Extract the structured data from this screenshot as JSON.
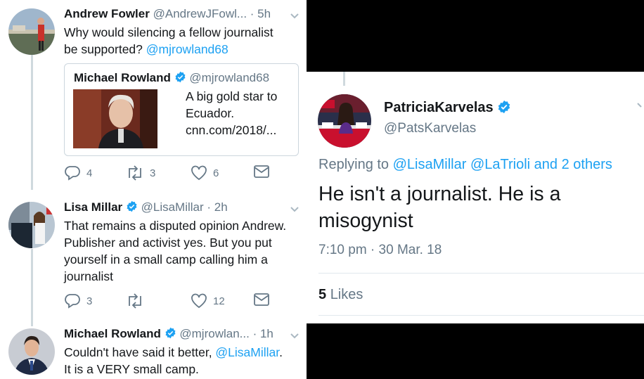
{
  "tweets": [
    {
      "name": "Andrew Fowler",
      "handle": "@AndrewJFowl...",
      "time": "· 5h",
      "text_line1": "Why would silencing a fellow journalist",
      "text_line2_prefix": "be supported? ",
      "mention": "@mjrowland68",
      "quote": {
        "name": "Michael Rowland",
        "handle": "@mjrowland68",
        "text": "A big gold star to Ecuador. cnn.com/2018/..."
      },
      "replies": "4",
      "retweets": "3",
      "likes": "6"
    },
    {
      "name": "Lisa Millar",
      "handle": "@LisaMillar",
      "time": "· 2h",
      "text": "That remains a disputed opinion Andrew. Publisher and activist yes. But you put yourself in a small camp calling him a journalist",
      "replies": "3",
      "retweets": "",
      "likes": "12"
    },
    {
      "name": "Michael Rowland",
      "handle": "@mjrowlan...",
      "time": "· 1h",
      "text_prefix": "Couldn't have said it better, ",
      "mention": "@LisaMillar",
      "text_suffix": ".",
      "text_line2": "It is a VERY small camp."
    }
  ],
  "detail": {
    "name": "PatriciaKarvelas",
    "handle": "@PatsKarvelas",
    "replying_label": "Replying to",
    "replying_mentions": "@LisaMillar @LaTrioli",
    "replying_others": "and 2 others",
    "text": "He isn't a journalist. He is a misogynist",
    "timestamp": "7:10 pm · 30 Mar. 18",
    "likes_count": "5",
    "likes_label": "Likes"
  },
  "colors": {
    "link": "#1da1f2",
    "muted": "#657786",
    "verified": "#1da1f2",
    "thread_line": "#cfd9de"
  },
  "icons": [
    "reply-icon",
    "retweet-icon",
    "like-icon",
    "message-icon",
    "verified-badge-icon",
    "chevron-down-icon"
  ]
}
